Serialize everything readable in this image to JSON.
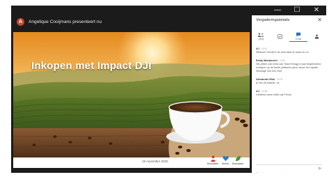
{
  "presenter": {
    "initial": "A",
    "text": "Angelique Cooijmans presenteert nu"
  },
  "window_controls": {
    "minimize": "—",
    "maximize": "☐",
    "close": "✕"
  },
  "slide": {
    "title": "Inkopen met Impact DJI",
    "date": "19 november 2020",
    "logos": [
      {
        "label": "Duurzaam",
        "icon": "person-logo-icon",
        "color": "#d7322d"
      },
      {
        "label": "Divers",
        "icon": "heart-logo-icon",
        "color": "#2e7bbf"
      },
      {
        "label": "Duurzaam",
        "icon": "leaf-logo-icon",
        "color": "#3e9a3a"
      }
    ]
  },
  "panel": {
    "title": "Vergaderingsdetails",
    "close": "✕",
    "tabs": [
      {
        "label": "(10)",
        "icon": "people-icon"
      },
      {
        "label": "",
        "icon": "checklist-icon"
      },
      {
        "label": "Chat",
        "icon": "chat-icon"
      },
      {
        "label": "",
        "icon": "org-icon"
      }
    ],
    "messages": [
      {
        "name": "AJ",
        "time": "10:47",
        "text": "Welkom! Schrijf in de chat waar je naam is u.b."
      },
      {
        "name": "Emily Mankovich",
        "time": "10:47",
        "text": "Wij zetten ook extra van Team Bringg in aan begeleidend schrijven op de beide platforms (dus: stuurt een aparte message met een link)"
      },
      {
        "name": "Alexander Mok",
        "time": "10:47",
        "text": "je ziet de kwartie, ok"
      },
      {
        "name": "AJ",
        "time": "10:48",
        "text": "Liefdesur deze slide! wij Prima!"
      }
    ],
    "compose_placeholder": "Bericht versturen aan iedereen"
  },
  "colors": {
    "accent": "#2f6fb5",
    "window_bg": "#1b1b1b",
    "avatar": "#c7472c"
  }
}
